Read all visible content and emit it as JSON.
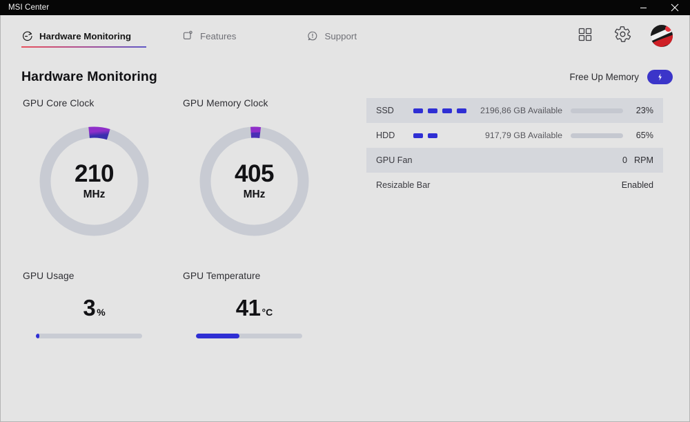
{
  "window": {
    "title": "MSI Center",
    "minimize_label": "Minimize",
    "close_label": "Close"
  },
  "nav": {
    "tabs": [
      {
        "label": "Hardware Monitoring",
        "icon": "monitor-dial-icon",
        "active": true
      },
      {
        "label": "Features",
        "icon": "feature-square-icon",
        "active": false
      },
      {
        "label": "Support",
        "icon": "support-bubble-icon",
        "active": false
      }
    ],
    "right_icons": [
      {
        "name": "apps-grid-icon"
      },
      {
        "name": "settings-gear-icon"
      },
      {
        "name": "user-avatar"
      }
    ],
    "underline_gradient_from": "#e8505b",
    "underline_gradient_to": "#5f58c6"
  },
  "header": {
    "title": "Hardware Monitoring",
    "free_up_memory_label": "Free Up Memory",
    "free_up_memory_icon": "lightning-bolt-icon"
  },
  "metrics": {
    "gauges": [
      {
        "label": "GPU Core Clock",
        "value": "210",
        "unit": "MHz",
        "arc_start_deg": -6,
        "arc_sweep_deg": 23
      },
      {
        "label": "GPU Memory Clock",
        "value": "405",
        "unit": "MHz",
        "arc_start_deg": -4,
        "arc_sweep_deg": 11
      }
    ],
    "bars": [
      {
        "label": "GPU Usage",
        "value": "3",
        "unit": "%",
        "percent": 3
      },
      {
        "label": "GPU Temperature",
        "value": "41",
        "unit": "°C",
        "percent": 41
      }
    ]
  },
  "status_list": [
    {
      "name": "SSD",
      "segments": 4,
      "available": "2196,86 GB Available",
      "percent_label": "23%",
      "percent": 23,
      "shaded": true
    },
    {
      "name": "HDD",
      "segments": 2,
      "available": "917,79 GB Available",
      "percent_label": "65%",
      "percent": 65,
      "shaded": false
    },
    {
      "name": "GPU Fan",
      "value": "0",
      "unit": "RPM",
      "shaded": true
    },
    {
      "name": "Resizable Bar",
      "value": "Enabled",
      "shaded": false
    }
  ],
  "colors": {
    "accent_blue": "#2f2fd4",
    "gauge_arc_from": "#7b2fc4",
    "gauge_arc_to": "#3b2fb0",
    "gauge_track": "#c8cbd3",
    "app_background": "#e4e4e4",
    "titlebar": "#060606"
  }
}
